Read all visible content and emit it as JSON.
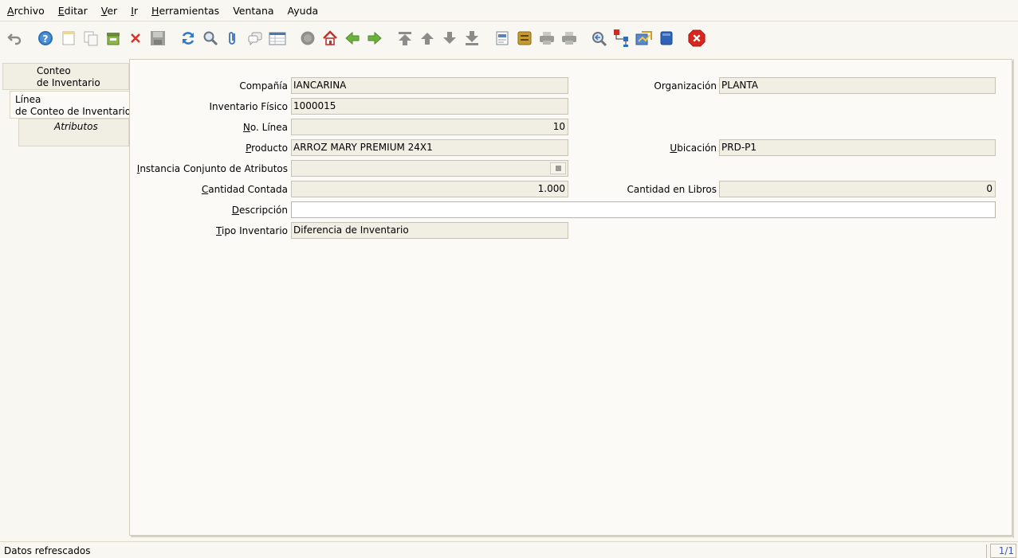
{
  "menu": [
    {
      "pre": "",
      "u": "A",
      "post": "rchivo"
    },
    {
      "pre": "",
      "u": "E",
      "post": "ditar"
    },
    {
      "pre": "",
      "u": "V",
      "post": "er"
    },
    {
      "pre": "",
      "u": "I",
      "post": "r"
    },
    {
      "pre": "",
      "u": "H",
      "post": "erramientas"
    },
    {
      "pre": "",
      "u": "V",
      "post": "entana"
    },
    {
      "pre": "",
      "u": "A",
      "post": "yuda"
    }
  ],
  "toolbar": {
    "icons": [
      "undo-icon",
      "help-icon",
      "new-record-icon",
      "copy-record-icon",
      "delete-selection-icon",
      "delete-record-icon",
      "save-icon",
      "refresh-icon",
      "find-icon",
      "attachment-icon",
      "chat-icon",
      "grid-toggle-icon",
      "history-icon",
      "home-icon",
      "parent-record-icon",
      "detail-record-icon",
      "first-record-icon",
      "previous-record-icon",
      "next-record-icon",
      "last-record-icon",
      "report-icon",
      "archive-icon",
      "print-preview-icon",
      "print-icon",
      "zoom-across-icon",
      "active-workflows-icon",
      "request-icon",
      "product-info-icon",
      "close-window-icon"
    ]
  },
  "tabs": {
    "tab1_line1": "Conteo",
    "tab1_line2": "de Inventario",
    "tab2_line1": "Línea",
    "tab2_line2": "de Conteo de Inventario",
    "tab3": "Atributos"
  },
  "form": {
    "company_label": "Compañía",
    "company_value": "IANCARINA",
    "org_label": "Organización",
    "org_value": "PLANTA",
    "phys_inv_label": "Inventario Físico",
    "phys_inv_value": "1000015",
    "line_label_u": "N",
    "line_label_rest": "o. Línea",
    "line_value": "10",
    "product_label_u": "P",
    "product_label_rest": "roducto",
    "product_value": "ARROZ MARY PREMIUM 24X1",
    "locator_label_u": "U",
    "locator_label_rest": "bicación",
    "locator_value": "PRD-P1",
    "attr_label_u": "I",
    "attr_label_rest": "nstancia Conjunto de Atributos",
    "attr_value": "",
    "qty_counted_label_u": "C",
    "qty_counted_label_rest": "antidad Contada",
    "qty_counted_value": "1.000",
    "qty_book_label": "Cantidad en Libros",
    "qty_book_value": "0",
    "desc_label_u": "D",
    "desc_label_rest": "escripción",
    "desc_value": "",
    "inv_type_label_u": "T",
    "inv_type_label_rest": "ipo Inventario",
    "inv_type_value": "Diferencia de Inventario"
  },
  "status": {
    "message": "Datos refrescados",
    "page": "1/1"
  }
}
